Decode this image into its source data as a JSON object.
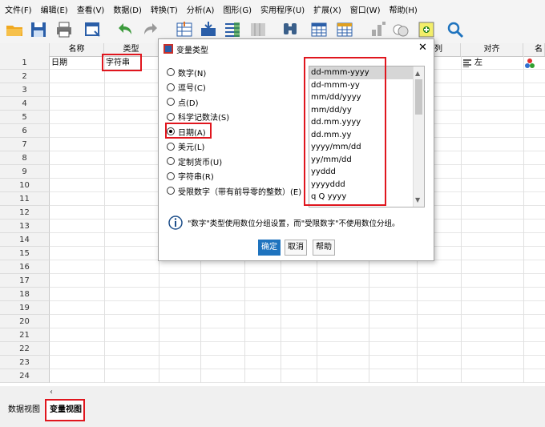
{
  "menu": [
    "文件(F)",
    "编辑(E)",
    "查看(V)",
    "数据(D)",
    "转换(T)",
    "分析(A)",
    "图形(G)",
    "实用程序(U)",
    "扩展(X)",
    "窗口(W)",
    "帮助(H)"
  ],
  "grid": {
    "headers": {
      "name": "名称",
      "type": "类型",
      "columns": "列",
      "align": "对齐",
      "measure": "名"
    },
    "row1": {
      "num": "1",
      "name": "日期",
      "type": "字符串",
      "align": "左"
    },
    "row_numbers": [
      "2",
      "3",
      "4",
      "5",
      "6",
      "7",
      "8",
      "9",
      "10",
      "11",
      "12",
      "13",
      "14",
      "15",
      "16",
      "17",
      "18",
      "19",
      "20",
      "21",
      "22",
      "23",
      "24"
    ]
  },
  "dialog": {
    "title": "变量类型",
    "radios": [
      {
        "label": "数字(N)",
        "checked": false
      },
      {
        "label": "逗号(C)",
        "checked": false
      },
      {
        "label": "点(D)",
        "checked": false
      },
      {
        "label": "科学记数法(S)",
        "checked": false
      },
      {
        "label": "日期(A)",
        "checked": true
      },
      {
        "label": "美元(L)",
        "checked": false
      },
      {
        "label": "定制货币(U)",
        "checked": false
      },
      {
        "label": "字符串(R)",
        "checked": false
      },
      {
        "label": "受限数字（带有前导零的整数）(E)",
        "checked": false
      }
    ],
    "formats": [
      "dd-mmm-yyyy",
      "dd-mmm-yy",
      "mm/dd/yyyy",
      "mm/dd/yy",
      "dd.mm.yyyy",
      "dd.mm.yy",
      "yyyy/mm/dd",
      "yy/mm/dd",
      "yyddd",
      "yyyyddd",
      "q Q yyyy"
    ],
    "info": "\"数字\"类型使用数位分组设置，而\"受限数字\"不使用数位分组。",
    "ok": "确定",
    "cancel": "取消",
    "help": "帮助"
  },
  "tabs": {
    "data_view": "数据视图",
    "variable_view": "变量视图"
  },
  "colors": {
    "accent": "#1e73be",
    "highlight": "#e0161e",
    "selected_item": "#d6d6d6"
  }
}
